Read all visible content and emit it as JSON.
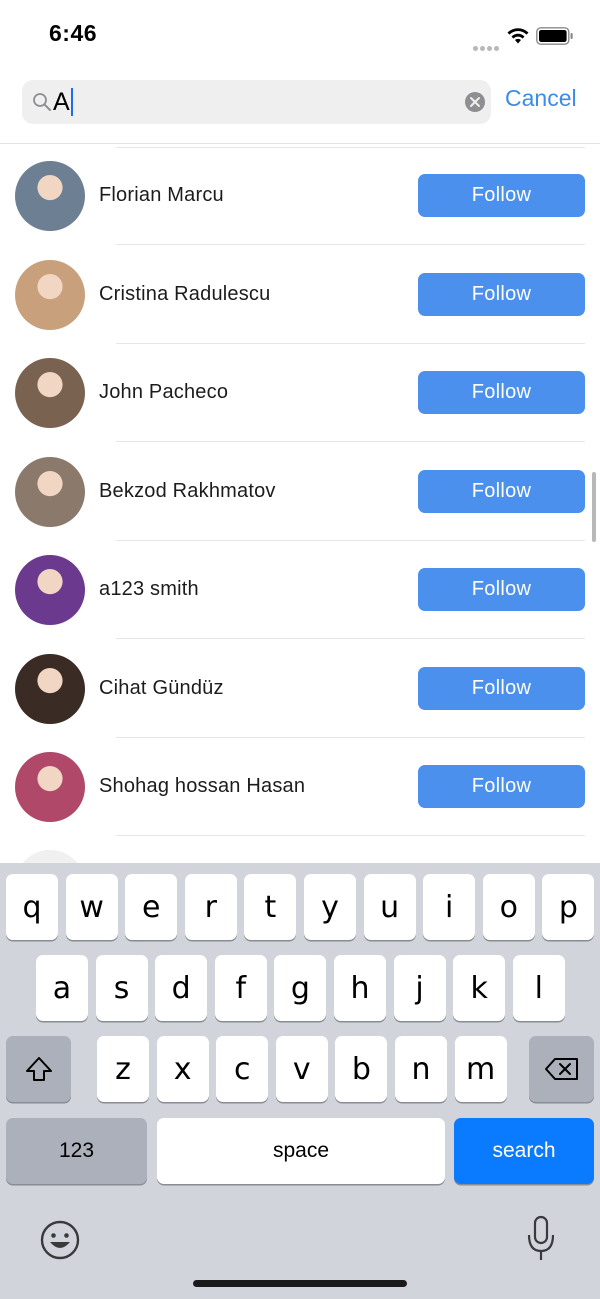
{
  "status_bar": {
    "time": "6:46"
  },
  "search": {
    "query": "A",
    "cancel_label": "Cancel"
  },
  "users": [
    {
      "name": "Florian Marcu",
      "button": "Follow",
      "avatar_color": "#6d7f92"
    },
    {
      "name": "Cristina Radulescu",
      "button": "Follow",
      "avatar_color": "#c9a07c"
    },
    {
      "name": "John Pacheco",
      "button": "Follow",
      "avatar_color": "#7a6251"
    },
    {
      "name": "Bekzod Rakhmatov",
      "button": "Follow",
      "avatar_color": "#8b7a6b"
    },
    {
      "name": "a123 smith",
      "button": "Follow",
      "avatar_color": "#6b3a8f"
    },
    {
      "name": "Cihat Gündüz",
      "button": "Follow",
      "avatar_color": "#3a2b24"
    },
    {
      "name": "Shohag hossan Hasan",
      "button": "Follow",
      "avatar_color": "#b0486a"
    }
  ],
  "keyboard": {
    "row1": [
      "q",
      "w",
      "e",
      "r",
      "t",
      "y",
      "u",
      "i",
      "o",
      "p"
    ],
    "row2": [
      "a",
      "s",
      "d",
      "f",
      "g",
      "h",
      "j",
      "k",
      "l"
    ],
    "row3": [
      "z",
      "x",
      "c",
      "v",
      "b",
      "n",
      "m"
    ],
    "numbers_label": "123",
    "space_label": "space",
    "search_label": "search"
  },
  "colors": {
    "accent": "#4a90ec",
    "cancel": "#3c8bea",
    "search_key": "#0a7aff"
  }
}
